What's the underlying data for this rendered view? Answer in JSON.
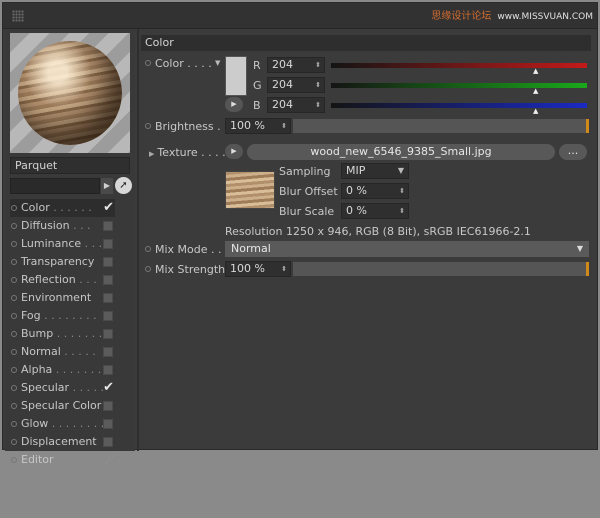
{
  "watermark": {
    "text": "思缘设计论坛",
    "url": "www.MISSVUAN.COM"
  },
  "material": {
    "name": "Parquet"
  },
  "channels": [
    {
      "label": "Color",
      "checked": true,
      "active": true
    },
    {
      "label": "Diffusion",
      "checked": false
    },
    {
      "label": "Luminance",
      "checked": false
    },
    {
      "label": "Transparency",
      "checked": false
    },
    {
      "label": "Reflection",
      "checked": false
    },
    {
      "label": "Environment",
      "checked": false
    },
    {
      "label": "Fog",
      "checked": false
    },
    {
      "label": "Bump",
      "checked": false
    },
    {
      "label": "Normal",
      "checked": false
    },
    {
      "label": "Alpha",
      "checked": false
    },
    {
      "label": "Specular",
      "checked": true
    },
    {
      "label": "Specular Color",
      "checked": false
    },
    {
      "label": "Glow",
      "checked": false
    },
    {
      "label": "Displacement",
      "checked": false
    },
    {
      "label": "Editor",
      "checked": false
    }
  ],
  "color_section": {
    "title": "Color",
    "color_label": "Color",
    "swatch_color": "#cccccc",
    "r_label": "R",
    "r_value": "204",
    "r_level": 0.8,
    "g_label": "G",
    "g_value": "204",
    "g_level": 0.8,
    "b_label": "B",
    "b_value": "204",
    "b_level": 0.8,
    "brightness_label": "Brightness",
    "brightness_value": "100 %",
    "texture_label": "Texture",
    "texture_file": "wood_new_6546_9385_Small.jpg",
    "dots_label": "...",
    "sampling_label": "Sampling",
    "sampling_value": "MIP",
    "blur_offset_label": "Blur Offset",
    "blur_offset_value": "0 %",
    "blur_scale_label": "Blur Scale",
    "blur_scale_value": "0 %",
    "resolution_text": "Resolution 1250 x 946, RGB (8 Bit), sRGB IEC61966-2.1",
    "mix_mode_label": "Mix Mode",
    "mix_mode_value": "Normal",
    "mix_strength_label": "Mix Strength",
    "mix_strength_value": "100 %"
  }
}
